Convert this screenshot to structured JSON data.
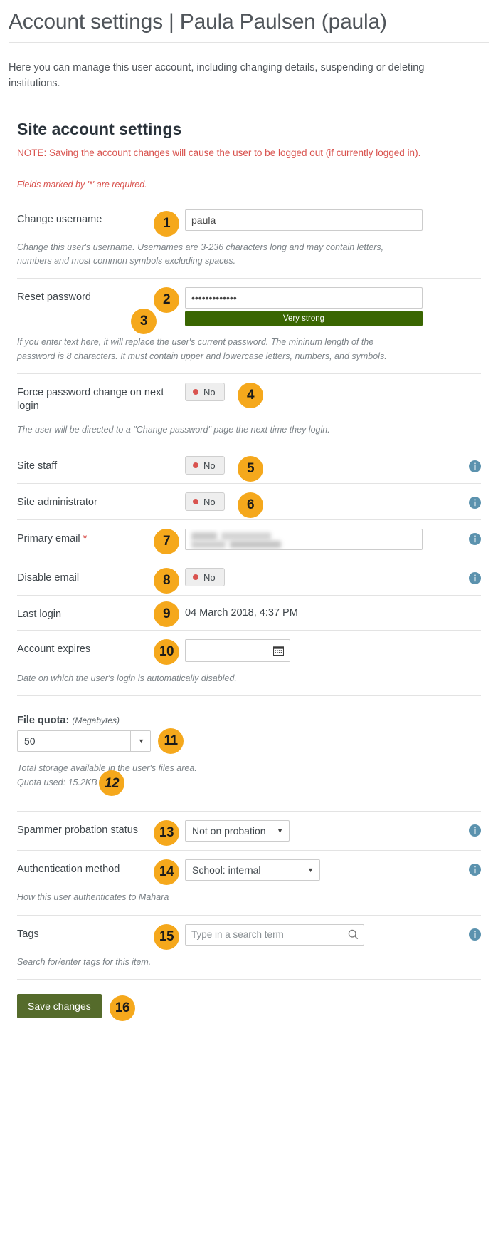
{
  "header": {
    "title": "Account settings | Paula Paulsen (paula)",
    "intro": "Here you can manage this user account, including changing details, suspending or deleting institutions."
  },
  "form": {
    "section_title": "Site account settings",
    "note": "NOTE: Saving the account changes will cause the user to be logged out (if currently logged in).",
    "required_note": "Fields marked by '*' are required.",
    "username": {
      "label": "Change username",
      "value": "paula",
      "help": "Change this user's username. Usernames are 3-236 characters long and may contain letters, numbers and most common symbols excluding spaces."
    },
    "password": {
      "label": "Reset password",
      "value": "•••••••••••••",
      "strength": "Very strong",
      "help": "If you enter text here, it will replace the user's current password. The mininum length of the password is 8 characters. It must contain upper and lowercase letters, numbers, and symbols."
    },
    "force_password_change": {
      "label": "Force password change on next login",
      "value": "No",
      "help": "The user will be directed to a \"Change password\" page the next time they login."
    },
    "site_staff": {
      "label": "Site staff",
      "value": "No"
    },
    "site_admin": {
      "label": "Site administrator",
      "value": "No"
    },
    "primary_email": {
      "label": "Primary email",
      "required_mark": "*",
      "value": ""
    },
    "disable_email": {
      "label": "Disable email",
      "value": "No"
    },
    "last_login": {
      "label": "Last login",
      "value": "04 March 2018, 4:37 PM"
    },
    "account_expires": {
      "label": "Account expires",
      "value": "",
      "help": "Date on which the user's login is automatically disabled."
    },
    "file_quota": {
      "label": "File quota:",
      "units": "(Megabytes)",
      "value": "50",
      "help": "Total storage available in the user's files area.",
      "quota_used": "Quota used: 15.2KB"
    },
    "spammer_probation": {
      "label": "Spammer probation status",
      "value": "Not on probation"
    },
    "auth_method": {
      "label": "Authentication method",
      "value": "School: internal",
      "help": "How this user authenticates to Mahara"
    },
    "tags": {
      "label": "Tags",
      "placeholder": "Type in a search term",
      "value": "",
      "help": "Search for/enter tags for this item."
    },
    "save_label": "Save changes"
  },
  "badges": {
    "b1": "1",
    "b2": "2",
    "b3": "3",
    "b4": "4",
    "b5": "5",
    "b6": "6",
    "b7": "7",
    "b8": "8",
    "b9": "9",
    "b10": "10",
    "b11": "11",
    "b12": "12",
    "b13": "13",
    "b14": "14",
    "b15": "15",
    "b16": "16"
  },
  "colors": {
    "badge": "#f5a81c",
    "note_red": "#d9534f",
    "strength_green": "#3a6602",
    "save_green": "#556b2b",
    "info_blue": "#5b92ae"
  }
}
